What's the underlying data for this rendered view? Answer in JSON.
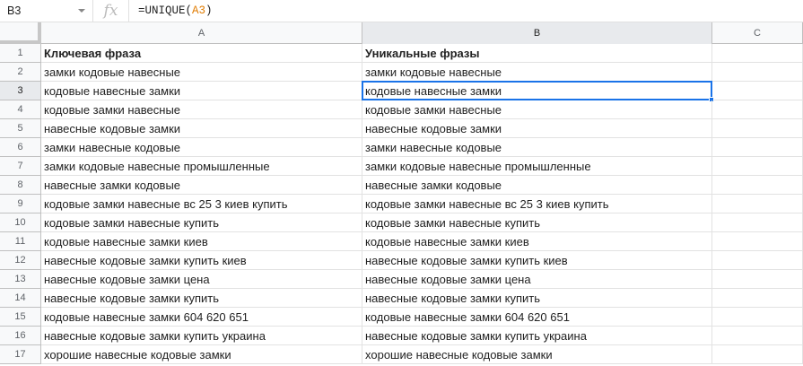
{
  "formula_bar": {
    "name_box": "B3",
    "fx_symbol": "fx",
    "formula_prefix": "=UNIQUE(",
    "formula_ref": "A3",
    "formula_suffix": ")"
  },
  "columns": [
    {
      "id": "A",
      "label": "A"
    },
    {
      "id": "B",
      "label": "B"
    },
    {
      "id": "C",
      "label": "C"
    }
  ],
  "selected": {
    "row": 3,
    "col": "B"
  },
  "rows": [
    {
      "num": "1",
      "a": "Ключевая фраза",
      "b": "Уникальные фразы",
      "header": true
    },
    {
      "num": "2",
      "a": "замки кодовые навесные",
      "b": "замки кодовые навесные"
    },
    {
      "num": "3",
      "a": "кодовые навесные замки",
      "b": "кодовые навесные замки"
    },
    {
      "num": "4",
      "a": "кодовые замки навесные",
      "b": "кодовые замки навесные"
    },
    {
      "num": "5",
      "a": "навесные кодовые замки",
      "b": "навесные кодовые замки"
    },
    {
      "num": "6",
      "a": "замки навесные кодовые",
      "b": "замки навесные кодовые"
    },
    {
      "num": "7",
      "a": "замки кодовые навесные промышленные",
      "b": "замки кодовые навесные промышленные"
    },
    {
      "num": "8",
      "a": "навесные замки кодовые",
      "b": "навесные замки кодовые"
    },
    {
      "num": "9",
      "a": "кодовые замки навесные вс 25 3 киев купить",
      "b": "кодовые замки навесные вс 25 3 киев купить"
    },
    {
      "num": "10",
      "a": "кодовые замки навесные купить",
      "b": "кодовые замки навесные купить"
    },
    {
      "num": "11",
      "a": "кодовые навесные замки киев",
      "b": "кодовые навесные замки киев"
    },
    {
      "num": "12",
      "a": "навесные кодовые замки купить киев",
      "b": "навесные кодовые замки купить киев"
    },
    {
      "num": "13",
      "a": "навесные кодовые замки цена",
      "b": "навесные кодовые замки цена"
    },
    {
      "num": "14",
      "a": "навесные кодовые замки купить",
      "b": "навесные кодовые замки купить"
    },
    {
      "num": "15",
      "a": "кодовые навесные замки 604 620 651",
      "b": "кодовые навесные замки 604 620 651"
    },
    {
      "num": "16",
      "a": "навесные кодовые замки купить украина",
      "b": "навесные кодовые замки купить украина"
    },
    {
      "num": "17",
      "a": "хорошие навесные кодовые замки",
      "b": "хорошие навесные кодовые замки"
    }
  ]
}
